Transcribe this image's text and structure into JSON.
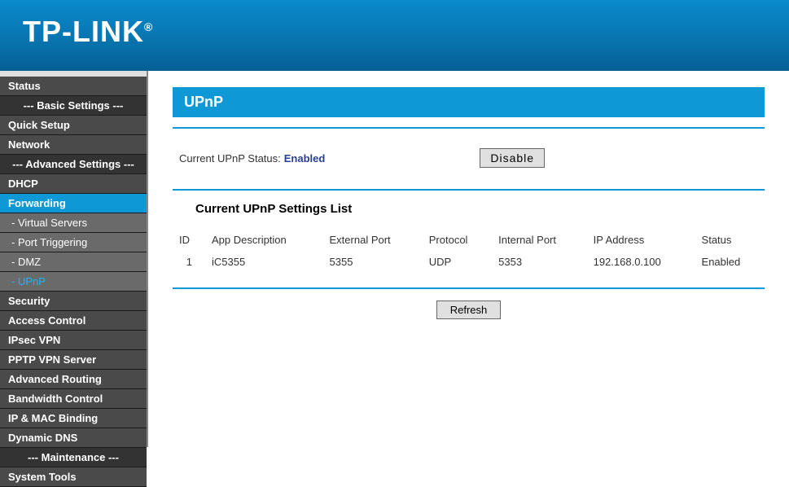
{
  "brand": "TP-LINK",
  "brand_tm": "®",
  "sidebar": {
    "items": [
      {
        "label": "Status",
        "type": "item"
      },
      {
        "label": "--- Basic Settings ---",
        "type": "section"
      },
      {
        "label": "Quick Setup",
        "type": "item"
      },
      {
        "label": "Network",
        "type": "item"
      },
      {
        "label": "--- Advanced Settings ---",
        "type": "section"
      },
      {
        "label": "DHCP",
        "type": "item"
      },
      {
        "label": "Forwarding",
        "type": "item",
        "selected": true
      },
      {
        "label": "- Virtual Servers",
        "type": "sub"
      },
      {
        "label": "- Port Triggering",
        "type": "sub"
      },
      {
        "label": "- DMZ",
        "type": "sub"
      },
      {
        "label": "- UPnP",
        "type": "sub",
        "selected": true
      },
      {
        "label": "Security",
        "type": "item"
      },
      {
        "label": "Access Control",
        "type": "item"
      },
      {
        "label": "IPsec VPN",
        "type": "item"
      },
      {
        "label": "PPTP VPN Server",
        "type": "item"
      },
      {
        "label": "Advanced Routing",
        "type": "item"
      },
      {
        "label": "Bandwidth Control",
        "type": "item"
      },
      {
        "label": "IP & MAC Binding",
        "type": "item"
      },
      {
        "label": "Dynamic DNS",
        "type": "item"
      },
      {
        "label": "--- Maintenance ---",
        "type": "section"
      },
      {
        "label": "System Tools",
        "type": "item"
      }
    ]
  },
  "page": {
    "title": "UPnP",
    "status_label": "Current UPnP Status:",
    "status_value": "Enabled",
    "disable_label": "Disable",
    "list_title": "Current UPnP Settings List",
    "columns": {
      "id": "ID",
      "app": "App Description",
      "ext_port": "External Port",
      "protocol": "Protocol",
      "int_port": "Internal Port",
      "ip": "IP Address",
      "status": "Status"
    },
    "rows": [
      {
        "id": "1",
        "app": "iC5355",
        "ext_port": "5355",
        "protocol": "UDP",
        "int_port": "5353",
        "ip": "192.168.0.100",
        "status": "Enabled"
      }
    ],
    "refresh_label": "Refresh"
  }
}
